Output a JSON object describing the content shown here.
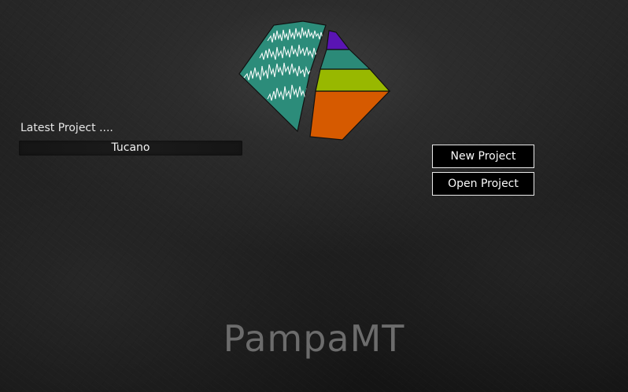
{
  "app": {
    "name": "PampaMT",
    "logo_icon": "pampamt-logo-icon"
  },
  "latest": {
    "label": "Latest Project ....",
    "projects": [
      "Tucano"
    ]
  },
  "actions": {
    "new_project": "New Project",
    "open_project": "Open Project"
  },
  "colors": {
    "logo_teal": "#2b8a78",
    "logo_purple": "#5a14b4",
    "logo_lime": "#98b800",
    "logo_orange": "#d85a00",
    "button_border": "#eaeaea",
    "title_text": "#6c6c6c"
  }
}
